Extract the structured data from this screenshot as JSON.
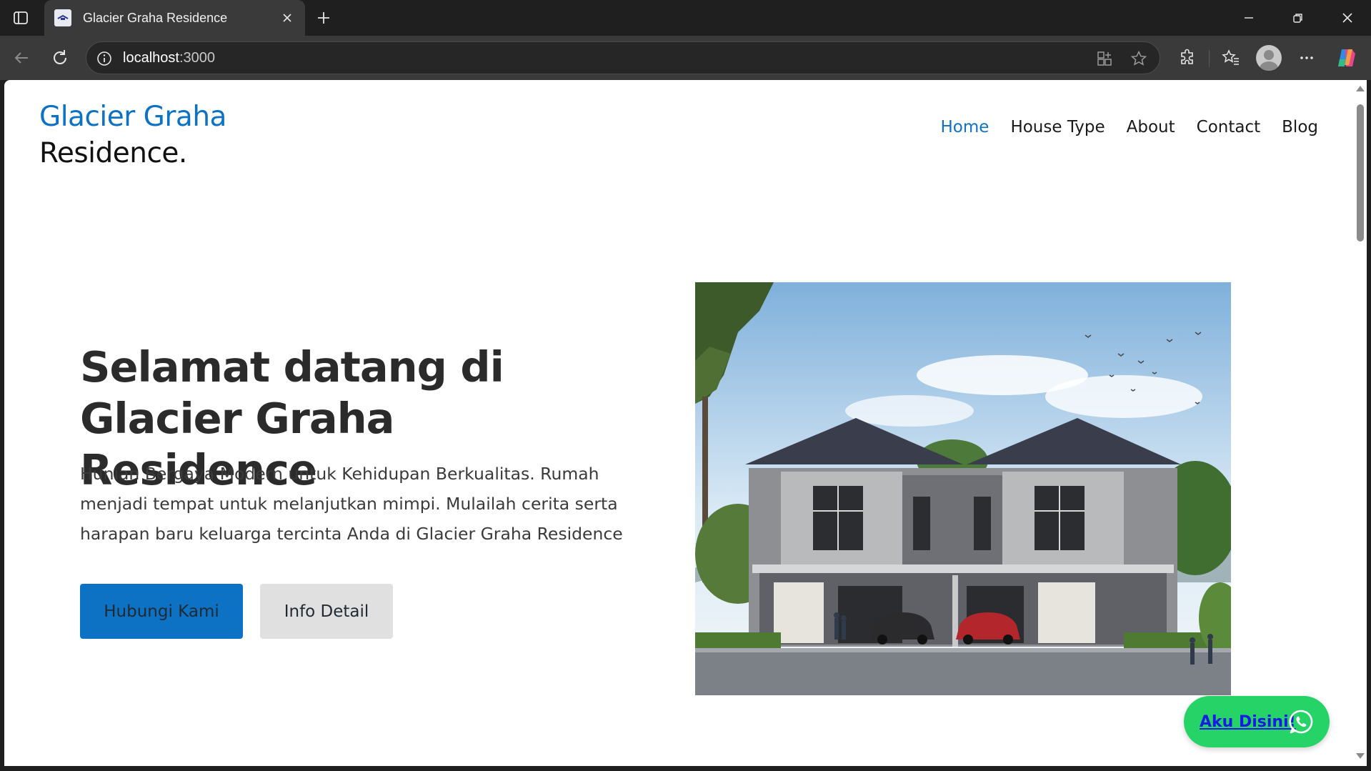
{
  "browser": {
    "tab_title": "Glacier Graha Residence",
    "url_host": "localhost",
    "url_rest": ":3000"
  },
  "site": {
    "logo_line1": "Glacier Graha",
    "logo_line2": "Residence.",
    "nav": [
      {
        "label": "Home",
        "active": true
      },
      {
        "label": "House Type"
      },
      {
        "label": "About"
      },
      {
        "label": "Contact"
      },
      {
        "label": "Blog"
      }
    ]
  },
  "hero": {
    "title": "Selamat datang di Glacier Graha Residence",
    "description": "Hunian Bergaya Modern untuk Kehidupan Berkualitas. Rumah menjadi tempat untuk melanjutkan mimpi. Mulailah cerita serta harapan baru keluarga tercinta Anda di Glacier Graha Residence",
    "primary_button": "Hubungi Kami",
    "secondary_button": "Info Detail"
  },
  "whatsapp": {
    "label": "Aku Disini!"
  },
  "colors": {
    "brand_blue": "#0d72c4",
    "whatsapp_green": "#25d366"
  }
}
